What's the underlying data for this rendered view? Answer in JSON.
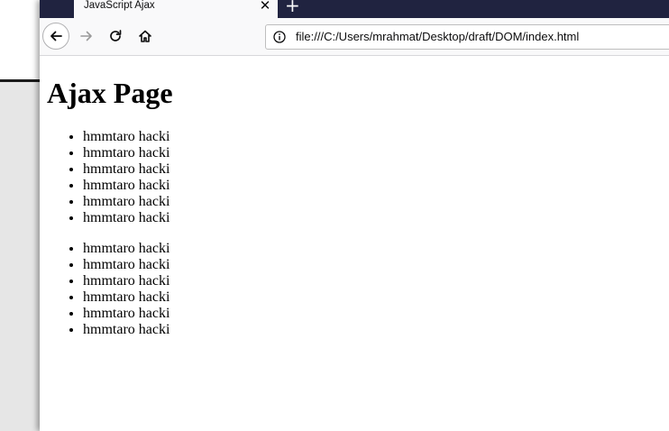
{
  "browser": {
    "tab_title": "JavaScript Ajax",
    "tab_close_glyph": "✕",
    "new_tab_glyph": "+",
    "url": "file:///C:/Users/mrahmat/Desktop/draft/DOM/index.html",
    "icons": [
      "back-arrow-icon",
      "forward-arrow-icon",
      "reload-icon",
      "home-icon",
      "info-icon"
    ]
  },
  "page": {
    "heading": "Ajax Page",
    "list_1": [
      "hmmtaro hacki",
      "hmmtaro hacki",
      "hmmtaro hacki",
      "hmmtaro hacki",
      "hmmtaro hacki",
      "hmmtaro hacki"
    ],
    "list_2": [
      "hmmtaro hacki",
      "hmmtaro hacki",
      "hmmtaro hacki",
      "hmmtaro hacki",
      "hmmtaro hacki",
      "hmmtaro hacki"
    ]
  },
  "colors": {
    "tabbar": "#202340",
    "toolbar": "#f9f9fa",
    "desktop_grey": "#e6e6e6"
  }
}
